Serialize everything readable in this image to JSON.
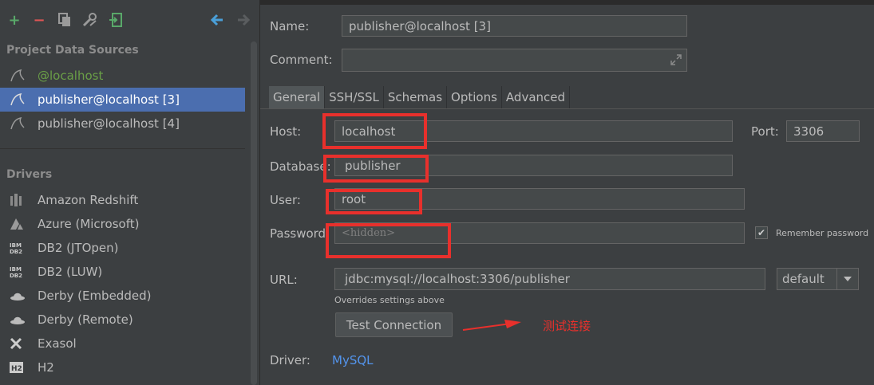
{
  "toolbar": {
    "icons": [
      "add-icon",
      "remove-icon",
      "copy-icon",
      "properties-icon",
      "import-icon",
      "back-icon",
      "forward-icon"
    ]
  },
  "project_sources": {
    "title": "Project Data Sources",
    "items": [
      {
        "label": "@localhost"
      },
      {
        "label": "publisher@localhost [3]"
      },
      {
        "label": "publisher@localhost [4]"
      }
    ]
  },
  "drivers": {
    "title": "Drivers",
    "items": [
      {
        "label": "Amazon Redshift"
      },
      {
        "label": "Azure (Microsoft)"
      },
      {
        "label": "DB2 (JTOpen)"
      },
      {
        "label": "DB2 (LUW)"
      },
      {
        "label": "Derby (Embedded)"
      },
      {
        "label": "Derby (Remote)"
      },
      {
        "label": "Exasol"
      },
      {
        "label": "H2"
      }
    ]
  },
  "form": {
    "name_label": "Name:",
    "name_value": "publisher@localhost [3]",
    "comment_label": "Comment:",
    "comment_value": "",
    "tabs": [
      "General",
      "SSH/SSL",
      "Schemas",
      "Options",
      "Advanced"
    ],
    "host_label": "Host:",
    "host_value": "localhost",
    "port_label": "Port:",
    "port_value": "3306",
    "database_label": "Database:",
    "database_value": "publisher",
    "user_label": "User:",
    "user_value": "root",
    "password_label": "Password:",
    "password_placeholder": "<hidden>",
    "remember_label": "Remember password",
    "remember_checked": true,
    "url_label": "URL:",
    "url_value": "jdbc:mysql://localhost:3306/publisher",
    "url_mode": "default",
    "overrides_note": "Overrides settings above",
    "test_button": "Test Connection",
    "annotation": "测试连接",
    "driver_label": "Driver:",
    "driver_value": "MySQL"
  },
  "colors": {
    "background": "#3c3f41",
    "selection": "#4b6eaf",
    "annotation_red": "#e8302c",
    "link": "#5394ec",
    "green_text": "#6a9f47"
  }
}
